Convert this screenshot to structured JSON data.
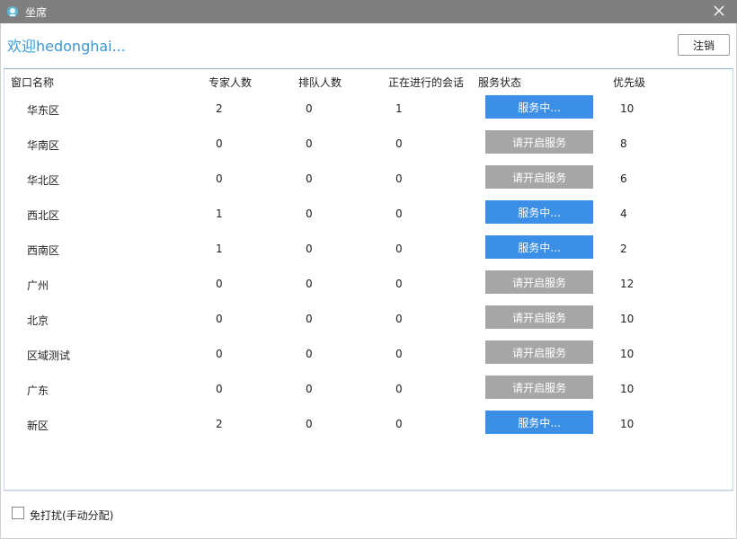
{
  "window": {
    "title": "坐席"
  },
  "header": {
    "welcome": "欢迎hedonghai...",
    "logout_label": "注销"
  },
  "table": {
    "columns": [
      "窗口名称",
      "专家人数",
      "排队人数",
      "正在进行的会话",
      "服务状态",
      "优先级"
    ],
    "rows": [
      {
        "name": "华东区",
        "experts": "2",
        "queue": "0",
        "sessions": "1",
        "status": "服务中...",
        "active": true,
        "priority": "10"
      },
      {
        "name": "华南区",
        "experts": "0",
        "queue": "0",
        "sessions": "0",
        "status": "请开启服务",
        "active": false,
        "priority": "8"
      },
      {
        "name": "华北区",
        "experts": "0",
        "queue": "0",
        "sessions": "0",
        "status": "请开启服务",
        "active": false,
        "priority": "6"
      },
      {
        "name": "西北区",
        "experts": "1",
        "queue": "0",
        "sessions": "0",
        "status": "服务中...",
        "active": true,
        "priority": "4"
      },
      {
        "name": "西南区",
        "experts": "1",
        "queue": "0",
        "sessions": "0",
        "status": "服务中...",
        "active": true,
        "priority": "2"
      },
      {
        "name": "广州",
        "experts": "0",
        "queue": "0",
        "sessions": "0",
        "status": "请开启服务",
        "active": false,
        "priority": "12"
      },
      {
        "name": "北京",
        "experts": "0",
        "queue": "0",
        "sessions": "0",
        "status": "请开启服务",
        "active": false,
        "priority": "10"
      },
      {
        "name": "区域测试",
        "experts": "0",
        "queue": "0",
        "sessions": "0",
        "status": "请开启服务",
        "active": false,
        "priority": "10"
      },
      {
        "name": "广东",
        "experts": "0",
        "queue": "0",
        "sessions": "0",
        "status": "请开启服务",
        "active": false,
        "priority": "10"
      },
      {
        "name": "新区",
        "experts": "2",
        "queue": "0",
        "sessions": "0",
        "status": "服务中...",
        "active": true,
        "priority": "10"
      }
    ]
  },
  "footer": {
    "dnd_label": "免打扰(手动分配)",
    "dnd_checked": false
  },
  "colors": {
    "active": "#3b8fe6",
    "inactive": "#a6a6a6",
    "accent": "#3a98d6",
    "titlebar": "#7f7f7f"
  },
  "icons": {
    "app": "headset-icon",
    "close": "close-icon"
  }
}
